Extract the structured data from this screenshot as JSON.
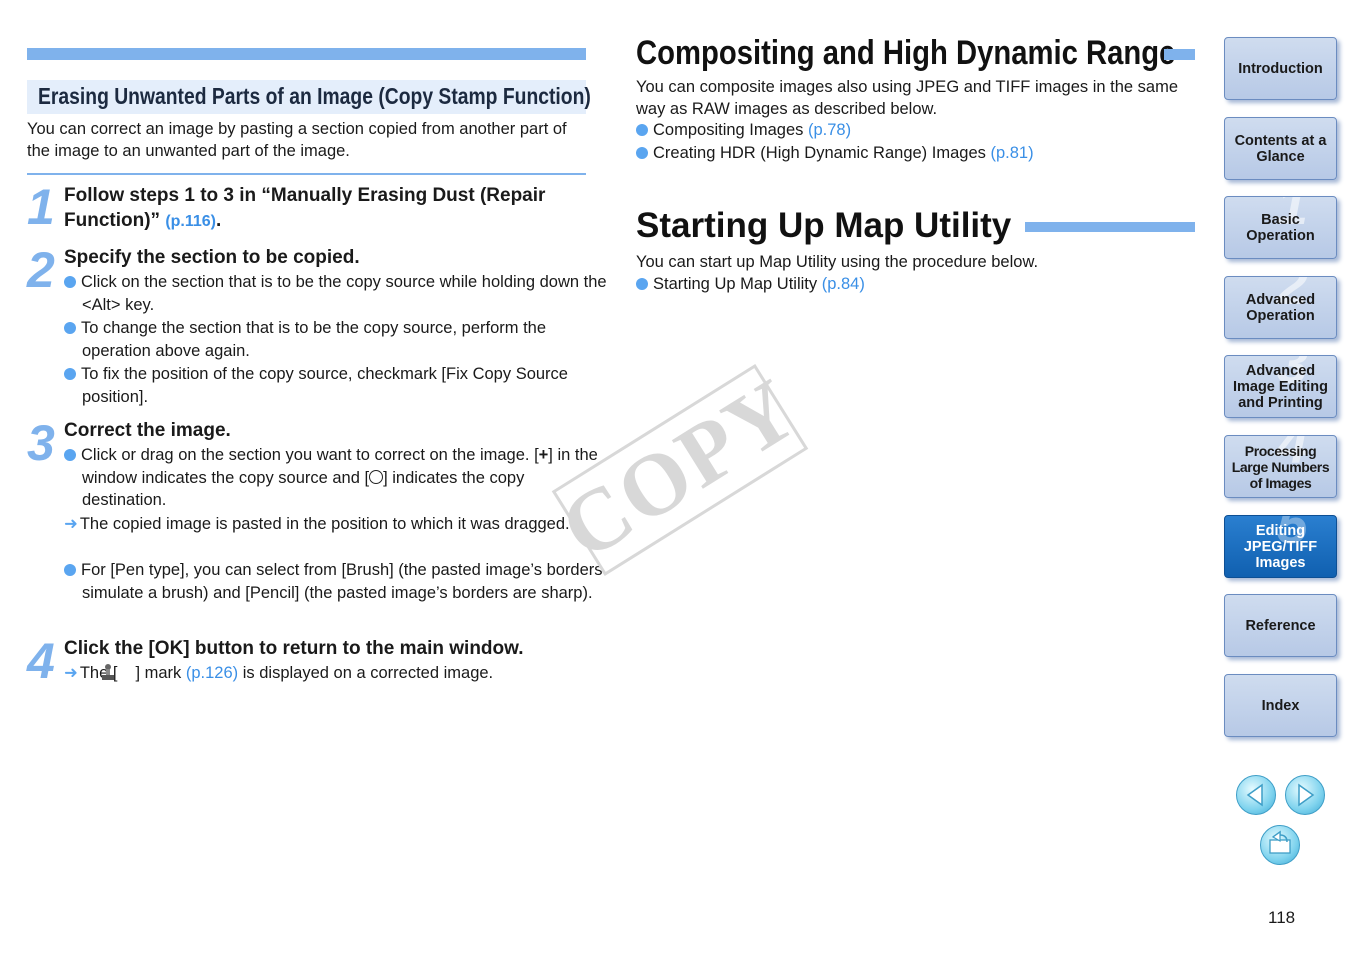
{
  "left": {
    "section_title": "Erasing Unwanted Parts of an Image (Copy Stamp Function)",
    "intro": "You can correct an image by pasting a section copied from another part of the image to an unwanted part of the image.",
    "steps": [
      {
        "num": "1",
        "title": "Follow steps 1 to 3 in “Manually Erasing Dust (Repair Function)”",
        "title_link": "(p.116)",
        "title_end": "."
      },
      {
        "num": "2",
        "title": "Specify the section to be copied."
      },
      {
        "num": "3",
        "title": "Correct the image."
      },
      {
        "num": "4",
        "title": "Click the [OK] button to return to the main window."
      }
    ],
    "step2_items": [
      "Click on the section that is to be the copy source while holding down the <Alt> key.",
      "To change the section that is to be the copy source, perform the operation above again.",
      "To fix the position of the copy source, checkmark [Fix Copy Source position]."
    ],
    "step3_item1_a": "Click or drag on the section you want to correct on the image. [",
    "step3_item1_plus": "+",
    "step3_item1_b": "] in the window indicates the copy source and [",
    "step3_item1_c": "] indicates the copy destination.",
    "step3_arrow": "The copied image is pasted in the position to which it was dragged.",
    "step3_item2": "For [Pen type], you can select from [Brush] (the pasted image’s borders simulate a brush) and [Pencil] (the pasted image’s borders are sharp).",
    "step4_arrow_a": "The [",
    "step4_arrow_b": "] mark",
    "step4_link": "(p.126)",
    "step4_arrow_c": "is displayed on a corrected image."
  },
  "right": {
    "h1_composite": "Compositing and High Dynamic Range",
    "composite_intro": "You can composite images also using JPEG and TIFF images in the same way as RAW images as described below.",
    "composite_items": [
      {
        "text": "Compositing Images",
        "link": "(p.78)"
      },
      {
        "text": "Creating HDR (High Dynamic Range) Images",
        "link": "(p.81)"
      }
    ],
    "h1_map": "Starting Up Map Utility",
    "map_intro": "You can start up Map Utility using the procedure below.",
    "map_items": [
      {
        "text": "Starting Up Map Utility",
        "link": "(p.84)"
      }
    ]
  },
  "watermark": "COPY",
  "nav": [
    {
      "label": "Introduction",
      "num": ""
    },
    {
      "label": "Contents at a Glance",
      "num": ""
    },
    {
      "label": "Basic Operation",
      "num": "1"
    },
    {
      "label": "Advanced Operation",
      "num": "2"
    },
    {
      "label": "Advanced Image Editing and Printing",
      "num": "3"
    },
    {
      "label": "Processing Large Numbers of Images",
      "num": "4"
    },
    {
      "label": "Editing JPEG/TIFF Images",
      "num": "5",
      "active": true
    },
    {
      "label": "Reference",
      "num": ""
    },
    {
      "label": "Index",
      "num": ""
    }
  ],
  "page_number": "118",
  "colors": {
    "accent": "#7fb2ec",
    "link": "#3a8fe6",
    "nav_active": "#1a6fc2"
  }
}
